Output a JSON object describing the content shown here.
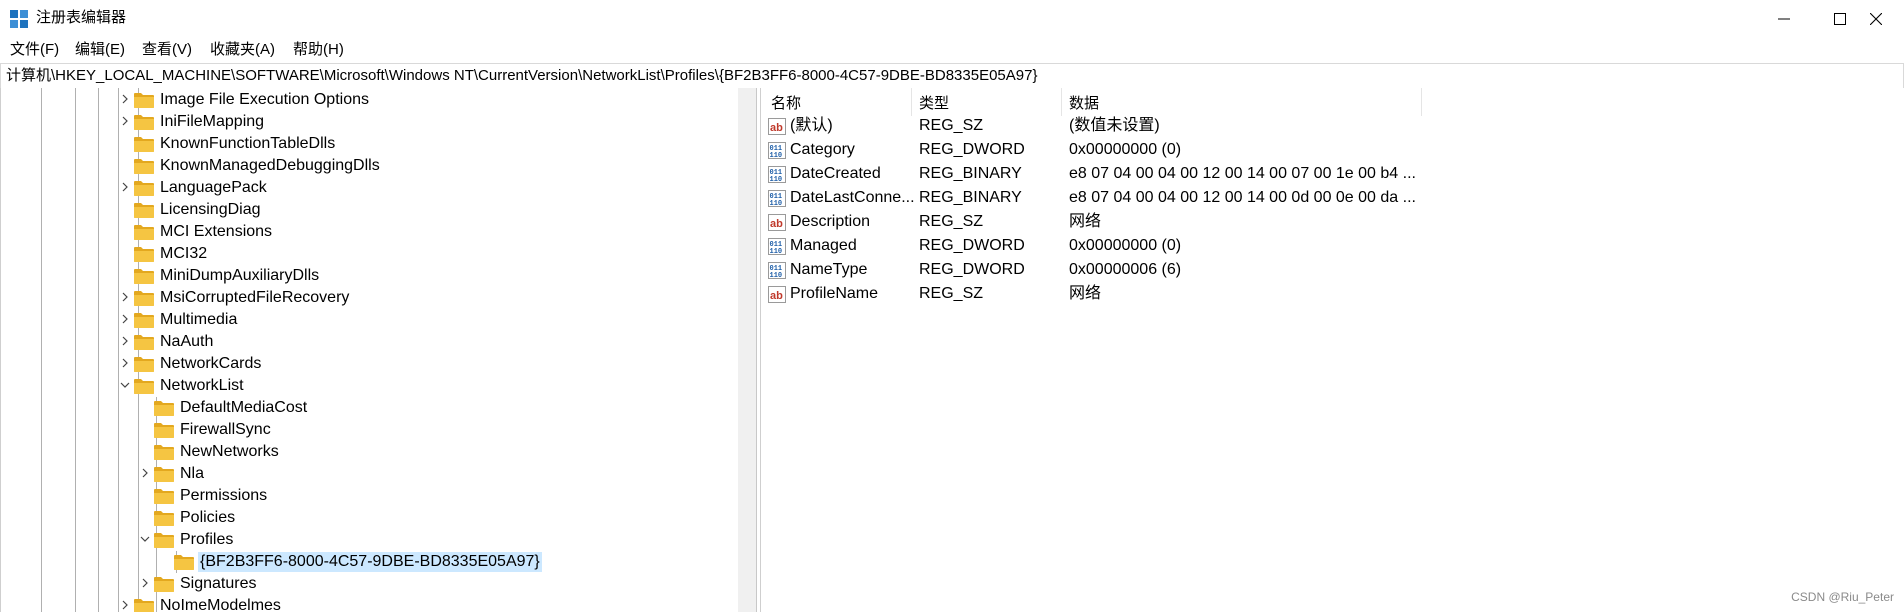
{
  "window": {
    "title": "注册表编辑器"
  },
  "menu": [
    "文件(F)",
    "编辑(E)",
    "查看(V)",
    "收藏夹(A)",
    "帮助(H)"
  ],
  "address": "计算机\\HKEY_LOCAL_MACHINE\\SOFTWARE\\Microsoft\\Windows NT\\CurrentVersion\\NetworkList\\Profiles\\{BF2B3FF6-8000-4C57-9DBE-BD8335E05A97}",
  "tree": [
    {
      "label": "Image File Execution Options",
      "level": 0,
      "chevron": "right"
    },
    {
      "label": "IniFileMapping",
      "level": 0,
      "chevron": "right"
    },
    {
      "label": "KnownFunctionTableDlls",
      "level": 0,
      "chevron": "none"
    },
    {
      "label": "KnownManagedDebuggingDlls",
      "level": 0,
      "chevron": "none"
    },
    {
      "label": "LanguagePack",
      "level": 0,
      "chevron": "right"
    },
    {
      "label": "LicensingDiag",
      "level": 0,
      "chevron": "none"
    },
    {
      "label": "MCI Extensions",
      "level": 0,
      "chevron": "none"
    },
    {
      "label": "MCI32",
      "level": 0,
      "chevron": "none"
    },
    {
      "label": "MiniDumpAuxiliaryDlls",
      "level": 0,
      "chevron": "none"
    },
    {
      "label": "MsiCorruptedFileRecovery",
      "level": 0,
      "chevron": "right"
    },
    {
      "label": "Multimedia",
      "level": 0,
      "chevron": "right"
    },
    {
      "label": "NaAuth",
      "level": 0,
      "chevron": "right"
    },
    {
      "label": "NetworkCards",
      "level": 0,
      "chevron": "right"
    },
    {
      "label": "NetworkList",
      "level": 0,
      "chevron": "down"
    },
    {
      "label": "DefaultMediaCost",
      "level": 1,
      "chevron": "none"
    },
    {
      "label": "FirewallSync",
      "level": 1,
      "chevron": "none"
    },
    {
      "label": "NewNetworks",
      "level": 1,
      "chevron": "none"
    },
    {
      "label": "Nla",
      "level": 1,
      "chevron": "right"
    },
    {
      "label": "Permissions",
      "level": 1,
      "chevron": "none"
    },
    {
      "label": "Policies",
      "level": 1,
      "chevron": "none"
    },
    {
      "label": "Profiles",
      "level": 1,
      "chevron": "down"
    },
    {
      "label": "{BF2B3FF6-8000-4C57-9DBE-BD8335E05A97}",
      "level": 2,
      "chevron": "none",
      "selected": true
    },
    {
      "label": "Signatures",
      "level": 1,
      "chevron": "right"
    },
    {
      "label": "NoImeModelmes",
      "level": 0,
      "chevron": "right"
    }
  ],
  "columns": {
    "name": "名称",
    "type": "类型",
    "data": "数据"
  },
  "values": [
    {
      "name": "(默认)",
      "type": "REG_SZ",
      "data": "(数值未设置)",
      "icon": "string"
    },
    {
      "name": "Category",
      "type": "REG_DWORD",
      "data": "0x00000000 (0)",
      "icon": "binary"
    },
    {
      "name": "DateCreated",
      "type": "REG_BINARY",
      "data": "e8 07 04 00 04 00 12 00 14 00 07 00 1e 00 b4 ...",
      "icon": "binary"
    },
    {
      "name": "DateLastConne...",
      "type": "REG_BINARY",
      "data": "e8 07 04 00 04 00 12 00 14 00 0d 00 0e 00 da ...",
      "icon": "binary"
    },
    {
      "name": "Description",
      "type": "REG_SZ",
      "data": "网络",
      "icon": "string"
    },
    {
      "name": "Managed",
      "type": "REG_DWORD",
      "data": "0x00000000 (0)",
      "icon": "binary"
    },
    {
      "name": "NameType",
      "type": "REG_DWORD",
      "data": "0x00000006 (6)",
      "icon": "binary"
    },
    {
      "name": "ProfileName",
      "type": "REG_SZ",
      "data": "网络",
      "icon": "string"
    }
  ],
  "watermark": "CSDN @Riu_Peter",
  "colors": {
    "folder": "#f5c542",
    "folder_dark": "#e3a81f",
    "selection": "#cce8ff",
    "icon_blue": "#1f5fa8",
    "icon_red": "#c0392b"
  }
}
